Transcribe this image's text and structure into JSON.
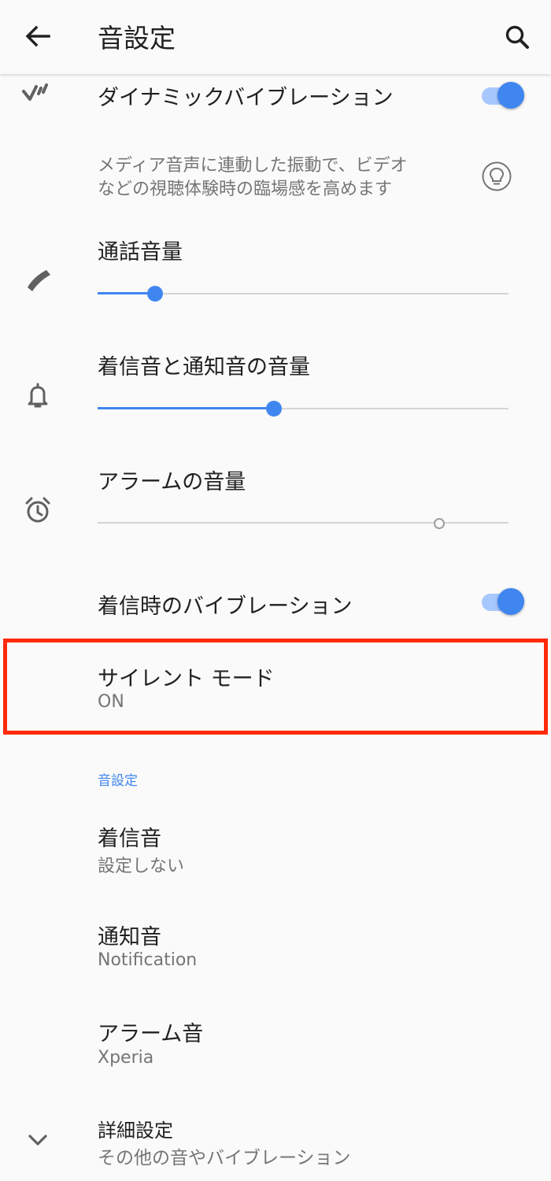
{
  "header": {
    "title": "音設定",
    "back_icon": "arrow-back-icon",
    "search_icon": "search-icon"
  },
  "dynamic_vibration": {
    "title": "ダイナミックバイブレーション",
    "enabled": true,
    "icon": "dynamic-vibration-icon",
    "description_line1": "メディア音声に連動した振動で、ビデオ",
    "description_line2": "などの視聴体験時の臨場感を高めます",
    "hint_icon": "lightbulb-icon"
  },
  "call_volume": {
    "title": "通話音量",
    "level": 0.14,
    "icon": "phone-icon"
  },
  "ring_volume": {
    "title": "着信音と通知音の音量",
    "level": 0.43,
    "icon": "bell-icon"
  },
  "alarm_volume": {
    "title": "アラームの音量",
    "level": 0.83,
    "icon": "alarm-clock-icon"
  },
  "vibrate_on_ring": {
    "title": "着信時のバイブレーション",
    "enabled": true
  },
  "silent_mode": {
    "title": "サイレント モード",
    "value": "ON"
  },
  "section": {
    "label": "音設定"
  },
  "ringtone": {
    "title": "着信音",
    "value": "設定しない"
  },
  "notification_sound": {
    "title": "通知音",
    "value": "Notification"
  },
  "alarm_sound": {
    "title": "アラーム音",
    "value": "Xperia"
  },
  "advanced": {
    "title": "詳細設定",
    "subtitle": "その他の音やバイブレーション",
    "icon": "chevron-down-icon"
  },
  "colors": {
    "accent": "#3f86f0",
    "highlight_border": "#ff2a0a",
    "toggle_track": "#a6c8ff"
  }
}
